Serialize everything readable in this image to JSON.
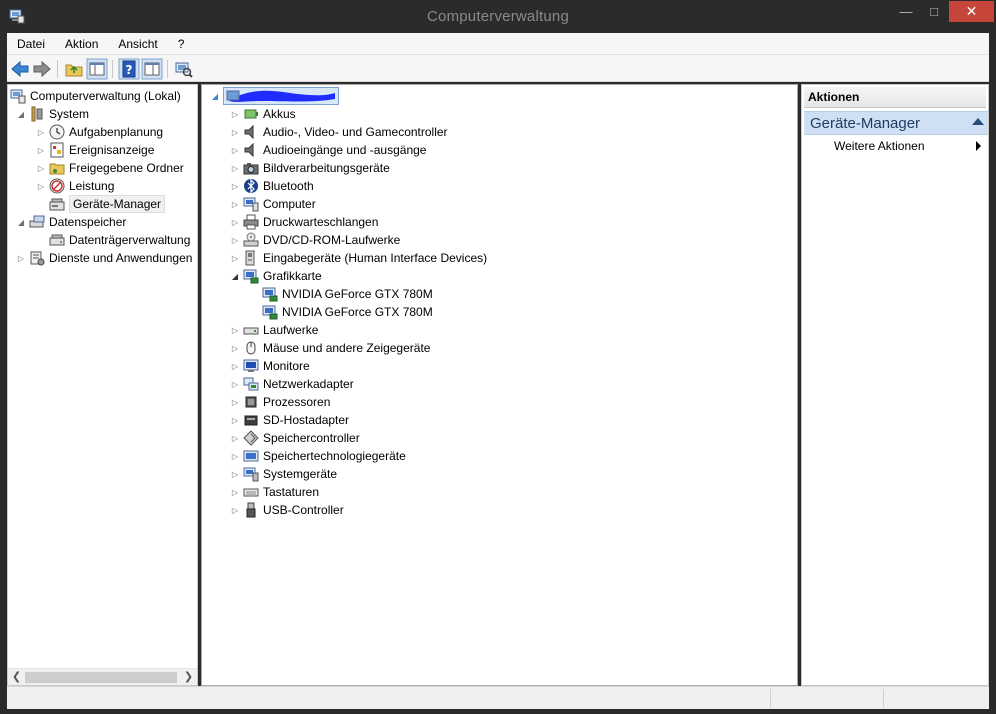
{
  "window": {
    "title": "Computerverwaltung"
  },
  "menu": {
    "items": [
      "Datei",
      "Aktion",
      "Ansicht",
      "?"
    ]
  },
  "toolbar": {
    "buttons": [
      "back-icon",
      "forward-icon",
      "up-folder-icon",
      "show-hide-tree-icon",
      "help-icon",
      "properties-icon",
      "scan-hardware-icon"
    ]
  },
  "left_tree": {
    "root": "Computerverwaltung (Lokal)",
    "system": "System",
    "system_children": [
      "Aufgabenplanung",
      "Ereignisanzeige",
      "Freigegebene Ordner",
      "Leistung",
      "Geräte-Manager"
    ],
    "storage": "Datenspeicher",
    "storage_children": [
      "Datenträgerverwaltung"
    ],
    "services": "Dienste und Anwendungen"
  },
  "device_tree": {
    "categories": [
      {
        "label": "Akkus",
        "icon": "battery-icon"
      },
      {
        "label": "Audio-, Video- und Gamecontroller",
        "icon": "speaker-icon"
      },
      {
        "label": "Audioeingänge und -ausgänge",
        "icon": "speaker-icon"
      },
      {
        "label": "Bildverarbeitungsgeräte",
        "icon": "camera-icon"
      },
      {
        "label": "Bluetooth",
        "icon": "bluetooth-icon"
      },
      {
        "label": "Computer",
        "icon": "computer-icon"
      },
      {
        "label": "Druckwarteschlangen",
        "icon": "printer-icon"
      },
      {
        "label": "DVD/CD-ROM-Laufwerke",
        "icon": "optical-drive-icon"
      },
      {
        "label": "Eingabegeräte (Human Interface Devices)",
        "icon": "hid-icon"
      },
      {
        "label": "Grafikkarte",
        "icon": "display-adapter-icon"
      },
      {
        "label": "Laufwerke",
        "icon": "disk-drive-icon"
      },
      {
        "label": "Mäuse und andere Zeigegeräte",
        "icon": "mouse-icon"
      },
      {
        "label": "Monitore",
        "icon": "monitor-icon"
      },
      {
        "label": "Netzwerkadapter",
        "icon": "network-icon"
      },
      {
        "label": "Prozessoren",
        "icon": "processor-icon"
      },
      {
        "label": "SD-Hostadapter",
        "icon": "sd-card-icon"
      },
      {
        "label": "Speichercontroller",
        "icon": "storage-controller-icon"
      },
      {
        "label": "Speichertechnologiegeräte",
        "icon": "memory-device-icon"
      },
      {
        "label": "Systemgeräte",
        "icon": "system-device-icon"
      },
      {
        "label": "Tastaturen",
        "icon": "keyboard-icon"
      },
      {
        "label": "USB-Controller",
        "icon": "usb-icon"
      }
    ],
    "gpu_children": [
      "NVIDIA GeForce GTX 780M",
      "NVIDIA GeForce GTX 780M"
    ]
  },
  "actions": {
    "header": "Aktionen",
    "section": "Geräte-Manager",
    "more": "Weitere Aktionen"
  },
  "colors": {
    "titlebar": "#2b2b2b",
    "close": "#c7463c",
    "section_bg": "#cfe0f5",
    "redaction": "#1f2bff"
  }
}
